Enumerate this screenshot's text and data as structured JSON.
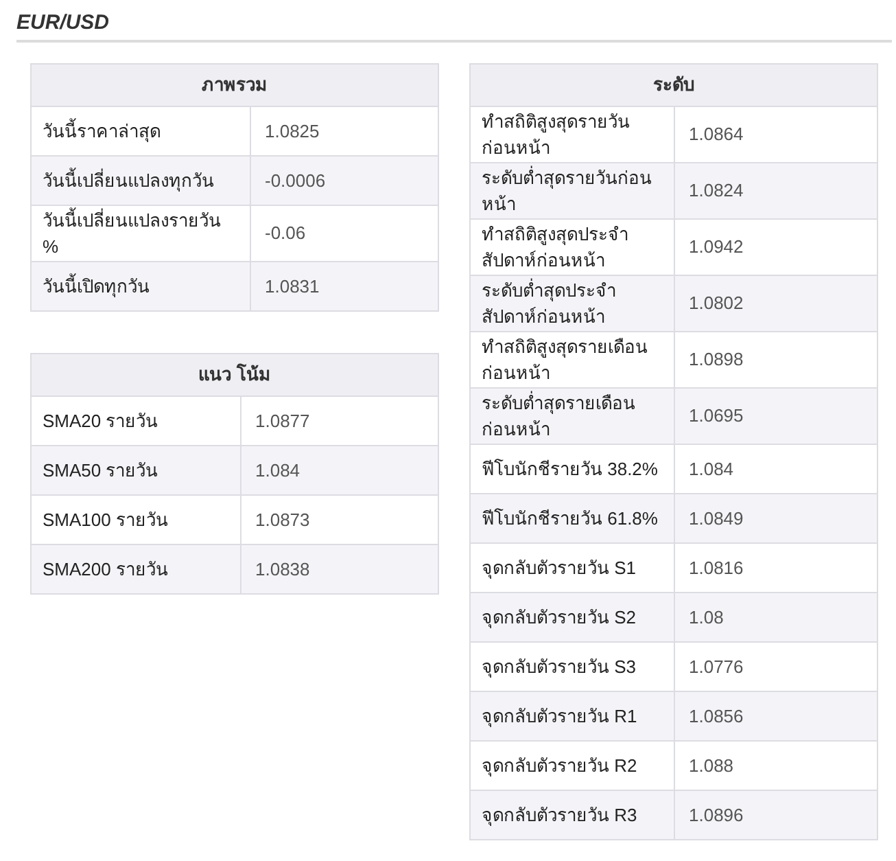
{
  "title": "EUR/USD",
  "tables": [
    {
      "heading": "ภาพรวม",
      "rows": [
        {
          "label": "วันนี้ราคาล่าสุด",
          "value": "1.0825"
        },
        {
          "label": "วันนี้เปลี่ยนแปลงทุกวัน",
          "value": "-0.0006"
        },
        {
          "label": "วันนี้เปลี่ยนแปลงรายวัน %",
          "value": "-0.06"
        },
        {
          "label": "วันนี้เปิดทุกวัน",
          "value": "1.0831"
        }
      ]
    },
    {
      "heading": "แนว โน้ม",
      "rows": [
        {
          "label": "SMA20 รายวัน",
          "value": "1.0877"
        },
        {
          "label": "SMA50 รายวัน",
          "value": "1.084"
        },
        {
          "label": "SMA100 รายวัน",
          "value": "1.0873"
        },
        {
          "label": "SMA200 รายวัน",
          "value": "1.0838"
        }
      ]
    },
    {
      "heading": "ระดับ",
      "rows": [
        {
          "label": "ทำสถิติสูงสุดรายวันก่อนหน้า",
          "value": "1.0864"
        },
        {
          "label": "ระดับต่ำสุดรายวันก่อนหน้า",
          "value": "1.0824"
        },
        {
          "label": "ทำสถิติสูงสุดประจำสัปดาห์ก่อนหน้า",
          "value": "1.0942"
        },
        {
          "label": "ระดับต่ำสุดประจำสัปดาห์ก่อนหน้า",
          "value": "1.0802"
        },
        {
          "label": "ทำสถิติสูงสุดรายเดือนก่อนหน้า",
          "value": "1.0898"
        },
        {
          "label": "ระดับต่ำสุดรายเดือนก่อนหน้า",
          "value": "1.0695"
        },
        {
          "label": "ฟีโบนักชีรายวัน 38.2%",
          "value": "1.084"
        },
        {
          "label": "ฟีโบนักชีรายวัน 61.8%",
          "value": "1.0849"
        },
        {
          "label": "จุดกลับตัวรายวัน S1",
          "value": "1.0816"
        },
        {
          "label": "จุดกลับตัวรายวัน S2",
          "value": "1.08"
        },
        {
          "label": "จุดกลับตัวรายวัน S3",
          "value": "1.0776"
        },
        {
          "label": "จุดกลับตัวรายวัน R1",
          "value": "1.0856"
        },
        {
          "label": "จุดกลับตัวรายวัน R2",
          "value": "1.088"
        },
        {
          "label": "จุดกลับตัวรายวัน R3",
          "value": "1.0896"
        }
      ]
    }
  ]
}
